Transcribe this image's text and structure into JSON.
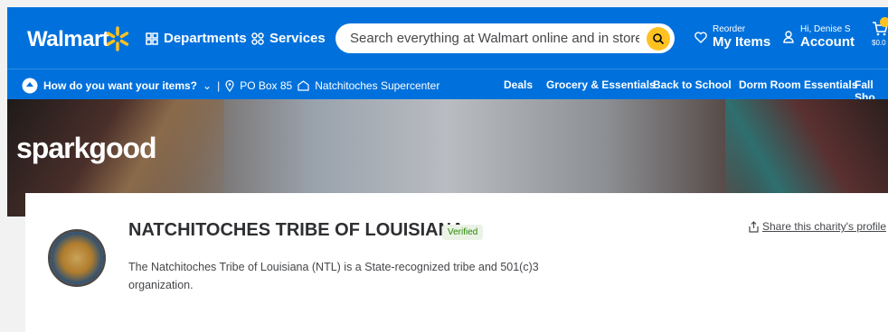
{
  "header": {
    "logo_text": "Walmart",
    "departments_label": "Departments",
    "services_label": "Services",
    "search_placeholder": "Search everything at Walmart online and in store",
    "reorder_small": "Reorder",
    "reorder_big": "My Items",
    "account_small": "Hi, Denise S",
    "account_big": "Account",
    "cart_total": "$0.0"
  },
  "subbar": {
    "how_label": "How do you want your items?",
    "address": "PO Box 85",
    "store": "Natchitoches Supercenter",
    "categories": [
      "Deals",
      "Grocery & Essentials",
      "Back to School",
      "Dorm Room Essentials",
      "Fall Sho"
    ]
  },
  "banner": {
    "brand_text": "sparkgood"
  },
  "charity": {
    "name": "NATCHITOCHES TRIBE OF LOUISIANA",
    "verified": "Verified",
    "share_label": "Share this charity's profile",
    "description": "The Natchitoches Tribe of Louisiana (NTL) is a State-recognized tribe and 501(c)3 organization."
  },
  "colors": {
    "brand_blue": "#0071dc",
    "spark_yellow": "#ffc220",
    "verified_green": "#2a8703"
  }
}
